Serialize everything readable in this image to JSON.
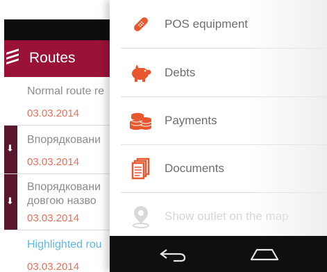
{
  "routes": {
    "title": "Routes",
    "items": [
      {
        "title": "Normal route re",
        "date": "03.03.2014",
        "marker": false
      },
      {
        "title": "Впорядковани",
        "date": "03.03.2014",
        "marker": true
      },
      {
        "title_line1": "Впорядковани",
        "title_line2": "довгою назво",
        "date": "03.03.2014",
        "marker": true
      },
      {
        "title": "Highlighted rou",
        "date": "03.03.2014",
        "marker": false,
        "highlighted": true
      }
    ]
  },
  "drawer": {
    "items": [
      {
        "label": "POS equipment",
        "icon": "bandage-icon"
      },
      {
        "label": "Debts",
        "icon": "piggy-bank-icon"
      },
      {
        "label": "Payments",
        "icon": "coins-icon"
      },
      {
        "label": "Documents",
        "icon": "documents-icon"
      },
      {
        "label": "Show outlet on the map",
        "icon": "map-pin-icon",
        "disabled": true
      }
    ]
  },
  "colors": {
    "header": "#9a1237",
    "marker": "#57182d",
    "date": "#e8705c",
    "icon_orange": "#e8572e",
    "highlight": "#5ab9e5"
  },
  "navbar": {
    "back": "back-icon",
    "home": "home-icon"
  }
}
